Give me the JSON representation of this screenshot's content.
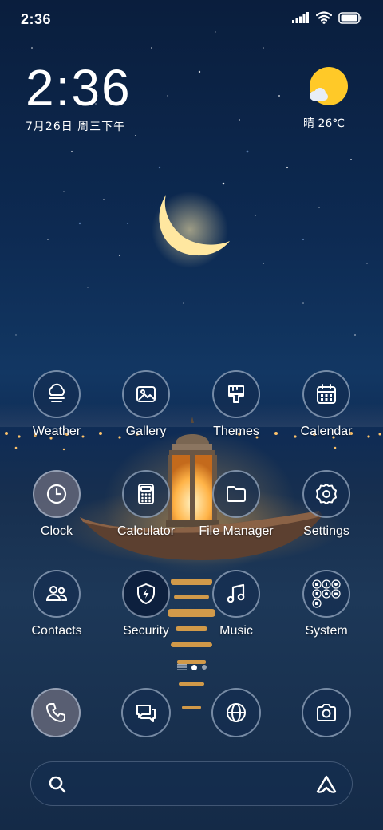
{
  "status_bar": {
    "time": "2:36",
    "icons": [
      "signal-icon",
      "wifi-icon",
      "battery-icon"
    ]
  },
  "clock_widget": {
    "time": "2:36",
    "date": "7月26日 周三下午"
  },
  "weather_widget": {
    "icon": "sunny-partly-cloudy-icon",
    "text": "晴 26℃"
  },
  "apps": [
    {
      "label": "Weather",
      "icon": "weather-icon"
    },
    {
      "label": "Gallery",
      "icon": "gallery-icon"
    },
    {
      "label": "Themes",
      "icon": "themes-brush-icon"
    },
    {
      "label": "Calendar",
      "icon": "calendar-icon"
    },
    {
      "label": "Clock",
      "icon": "clock-icon"
    },
    {
      "label": "Calculator",
      "icon": "calculator-icon"
    },
    {
      "label": "File Manager",
      "icon": "folder-icon"
    },
    {
      "label": "Settings",
      "icon": "gear-icon"
    },
    {
      "label": "Contacts",
      "icon": "contacts-icon"
    },
    {
      "label": "Security",
      "icon": "shield-bolt-icon"
    },
    {
      "label": "Music",
      "icon": "music-note-icon"
    },
    {
      "label": "System",
      "icon": "folder-grid-icon"
    }
  ],
  "page_indicator": {
    "pages": 2,
    "active": 1
  },
  "dock": [
    {
      "icon": "phone-icon"
    },
    {
      "icon": "messages-icon"
    },
    {
      "icon": "browser-globe-icon"
    },
    {
      "icon": "camera-icon"
    }
  ],
  "search_bar": {
    "left_icon": "search-icon",
    "right_icon": "assistant-icon"
  },
  "colors": {
    "sun": "#ffc928",
    "moon": "#ffe9a8",
    "lantern_glow": "#ffb347"
  }
}
